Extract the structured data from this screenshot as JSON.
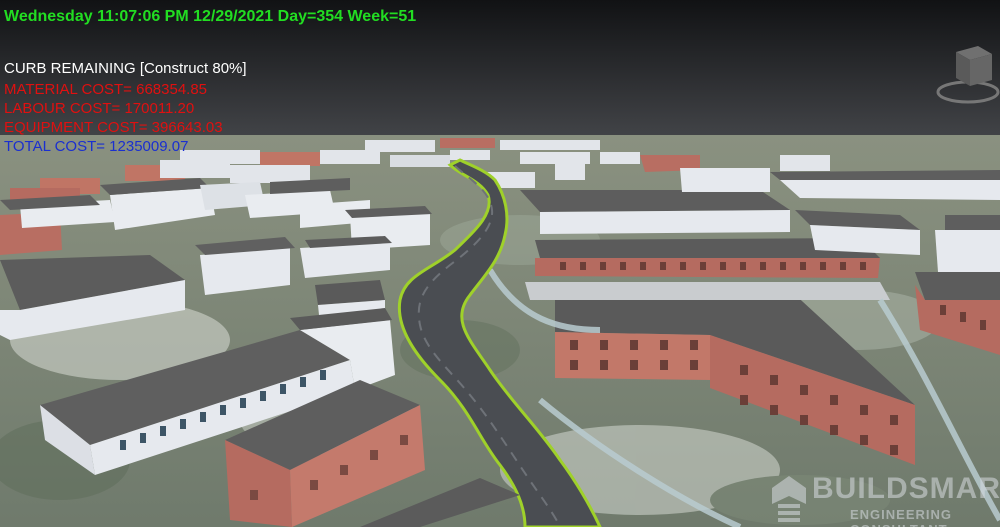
{
  "hud": {
    "datetime": "Wednesday 11:07:06 PM 12/29/2021 Day=354 Week=51",
    "status": "CURB REMAINING [Construct 80%]",
    "material_cost": "MATERIAL COST= 668354.85",
    "labour_cost": "LABOUR COST= 170011.20",
    "equipment_cost": "EQUIPMENT COST= 396643.03",
    "total_cost": "TOTAL COST= 1235009.07"
  },
  "colors": {
    "datetime": "#22dd22",
    "status": "#ffffff",
    "material": "#e01010",
    "labour": "#e01010",
    "equipment": "#e01010",
    "total": "#1a2fd0",
    "road": "#4a4d52",
    "curb": "#9fd12a",
    "roof": "#5a5a5a",
    "brick": "#b56b60",
    "white_building": "#e6e9ee"
  },
  "logo": {
    "title": "BUILDSMART",
    "subtitle": "ENGINEERING CONSULTANT"
  },
  "icons": {
    "navigation": "view-cube-icon",
    "logo_mark": "buildsmart-logo-icon"
  }
}
